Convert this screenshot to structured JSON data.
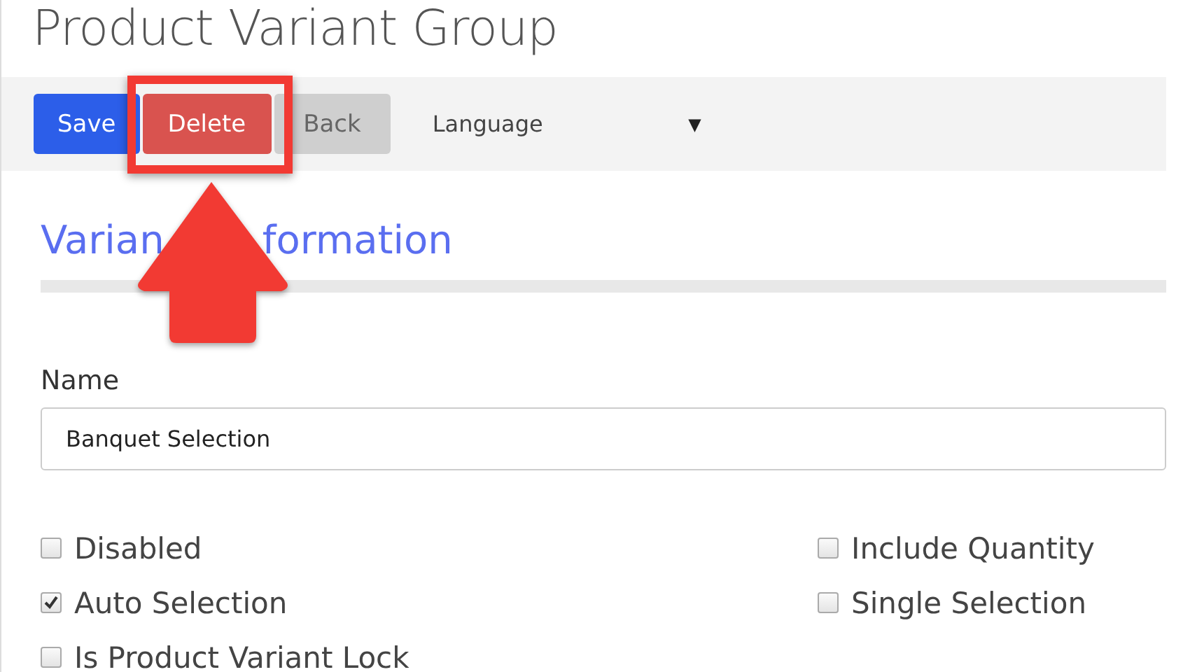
{
  "page": {
    "title": "Product Variant Group"
  },
  "toolbar": {
    "buttons": [
      {
        "label": "Save",
        "kind": "primary"
      },
      {
        "label": "Delete",
        "kind": "danger"
      },
      {
        "label": "Back",
        "kind": "default"
      }
    ],
    "language": {
      "label": "Language",
      "caret": "▼"
    }
  },
  "section": {
    "heading_parts": [
      "Varian",
      "formation"
    ]
  },
  "form": {
    "name_label": "Name",
    "name_value": "Banquet Selection",
    "checkboxes": [
      {
        "label": "Disabled",
        "checked": false
      },
      {
        "label": "Include Quantity",
        "checked": false
      },
      {
        "label": "Auto Selection",
        "checked": true
      },
      {
        "label": "Single Selection",
        "checked": false
      },
      {
        "label": "Is Product Variant Lock",
        "checked": false
      }
    ]
  }
}
